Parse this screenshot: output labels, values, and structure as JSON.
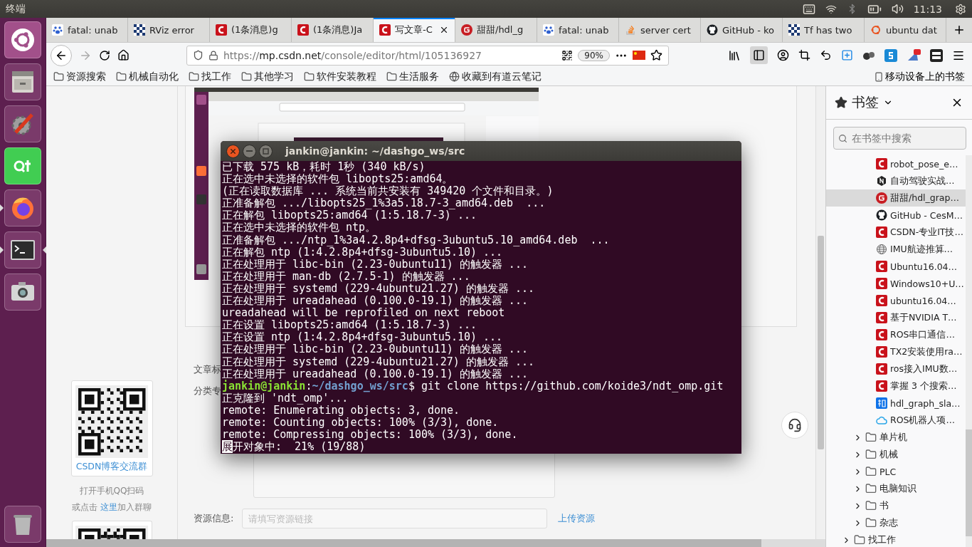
{
  "top_panel": {
    "title": "终端",
    "time": "11:13"
  },
  "launcher": [
    {
      "kind": "dash",
      "running": false,
      "focused": false
    },
    {
      "kind": "files",
      "running": false,
      "focused": false
    },
    {
      "kind": "settings",
      "running": false,
      "focused": false
    },
    {
      "kind": "qt",
      "running": false,
      "focused": false
    },
    {
      "kind": "firefox",
      "running": true,
      "focused": false
    },
    {
      "kind": "terminal",
      "running": true,
      "focused": true
    },
    {
      "kind": "camera",
      "running": false,
      "focused": false
    },
    {
      "kind": "trash",
      "running": false,
      "focused": false
    }
  ],
  "tabs": [
    {
      "title": "fatal: unab",
      "kind": "paw",
      "selected": false
    },
    {
      "title": "RViz error",
      "kind": "grid",
      "selected": false
    },
    {
      "title": "(1条消息)g",
      "kind": "csdn",
      "selected": false
    },
    {
      "title": "(1条消息)Ja",
      "kind": "csdn",
      "selected": false
    },
    {
      "title": "写文章-C",
      "kind": "csdn",
      "selected": true
    },
    {
      "title": "甜甜/hdl_g",
      "kind": "gitee",
      "selected": false
    },
    {
      "title": "fatal: unab",
      "kind": "paw",
      "selected": false
    },
    {
      "title": "server cert",
      "kind": "stack",
      "selected": false
    },
    {
      "title": "GitHub - ko",
      "kind": "github",
      "selected": false
    },
    {
      "title": "Tf has two",
      "kind": "grid",
      "selected": false
    },
    {
      "title": "ubuntu dat",
      "kind": "ubuntu",
      "selected": false
    }
  ],
  "toolbar": {
    "url_scheme": "https://",
    "url_host": "mp.csdn.net",
    "url_path": "/console/editor/html/105136927",
    "zoom": "90%"
  },
  "bookmarks_bar": [
    {
      "label": "资源搜索",
      "kind": "folder"
    },
    {
      "label": "机械自动化",
      "kind": "folder"
    },
    {
      "label": "找工作",
      "kind": "folder"
    },
    {
      "label": "其他学习",
      "kind": "folder"
    },
    {
      "label": "软件安装教程",
      "kind": "folder"
    },
    {
      "label": "生活服务",
      "kind": "folder"
    },
    {
      "label": "收藏到有道云笔记",
      "kind": "web"
    }
  ],
  "mobile_bookmarks": "移动设备上的书签",
  "qr_panel": {
    "caption": "CSDN博客交流群",
    "hint": "打开手机QQ扫码",
    "join_prefix": "或点击",
    "join_link": "这里",
    "join_suffix": "加入群聊"
  },
  "editor": {
    "tags_label": "文章标",
    "column_label": "分类专",
    "resource_label": "资源信息:",
    "resource_placeholder": "请填写资源链接",
    "upload_link": "上传资源"
  },
  "sidebar": {
    "title": "书签",
    "search_placeholder": "在书签中搜索",
    "bookmarks": [
      {
        "label": "robot_pose_e…",
        "kind": "csdn",
        "selected": false
      },
      {
        "label": "自动驾驶实战…",
        "kind": "hex",
        "selected": false
      },
      {
        "label": "甜甜/hdl_grap…",
        "kind": "gitee",
        "selected": true
      },
      {
        "label": "GitHub - CesM…",
        "kind": "github",
        "selected": false
      },
      {
        "label": "CSDN-专业IT技…",
        "kind": "csdn",
        "selected": false
      },
      {
        "label": "IMU航迹推算…",
        "kind": "globe",
        "selected": false
      },
      {
        "label": "Ubuntu16.04…",
        "kind": "csdn",
        "selected": false
      },
      {
        "label": "Windows10+U…",
        "kind": "csdn",
        "selected": false
      },
      {
        "label": "ubuntu16.04…",
        "kind": "csdn",
        "selected": false
      },
      {
        "label": "基于NVIDIA T…",
        "kind": "csdn",
        "selected": false
      },
      {
        "label": "ROS串口通信…",
        "kind": "csdn",
        "selected": false
      },
      {
        "label": "TX2安装使用ra…",
        "kind": "csdn",
        "selected": false
      },
      {
        "label": "ros接入IMU数…",
        "kind": "csdn",
        "selected": false
      },
      {
        "label": "掌握 3 个搜索…",
        "kind": "csdn",
        "selected": false
      },
      {
        "label": "hdl_graph_sla…",
        "kind": "zhihu",
        "selected": false
      },
      {
        "label": "ROS机器人项…",
        "kind": "cloud",
        "selected": false
      }
    ],
    "subfolders": [
      {
        "label": "单片机",
        "expanded": false
      },
      {
        "label": "机械",
        "expanded": false
      },
      {
        "label": "PLC",
        "expanded": false
      },
      {
        "label": "电脑知识",
        "expanded": false
      },
      {
        "label": "书",
        "expanded": false
      },
      {
        "label": "杂志",
        "expanded": false
      }
    ],
    "folders": [
      {
        "label": "找工作",
        "expanded": false
      }
    ]
  },
  "terminal": {
    "title": "jankin@jankin: ~/dashgo_ws/src",
    "lines": [
      {
        "kind": "output",
        "text": "已下载 575 kB，耗时 1秒 (340 kB/s)"
      },
      {
        "kind": "output",
        "text": "正在选中未选择的软件包 libopts25:amd64。"
      },
      {
        "kind": "output",
        "text": "(正在读取数据库 ... 系统当前共安装有 349420 个文件和目录。)"
      },
      {
        "kind": "output",
        "text": "正准备解包 .../libopts25_1%3a5.18.7-3_amd64.deb  ..."
      },
      {
        "kind": "output",
        "text": "正在解包 libopts25:amd64 (1:5.18.7-3) ..."
      },
      {
        "kind": "output",
        "text": "正在选中未选择的软件包 ntp。"
      },
      {
        "kind": "output",
        "text": "正准备解包 .../ntp_1%3a4.2.8p4+dfsg-3ubuntu5.10_amd64.deb  ..."
      },
      {
        "kind": "output",
        "text": "正在解包 ntp (1:4.2.8p4+dfsg-3ubuntu5.10) ..."
      },
      {
        "kind": "output",
        "text": "正在处理用于 libc-bin (2.23-0ubuntu11) 的触发器 ..."
      },
      {
        "kind": "output",
        "text": "正在处理用于 man-db (2.7.5-1) 的触发器 ..."
      },
      {
        "kind": "output",
        "text": "正在处理用于 systemd (229-4ubuntu21.27) 的触发器 ..."
      },
      {
        "kind": "output",
        "text": "正在处理用于 ureadahead (0.100.0-19.1) 的触发器 ..."
      },
      {
        "kind": "output",
        "text": "ureadahead will be reprofiled on next reboot"
      },
      {
        "kind": "output",
        "text": "正在设置 libopts25:amd64 (1:5.18.7-3) ..."
      },
      {
        "kind": "output",
        "text": "正在设置 ntp (1:4.2.8p4+dfsg-3ubuntu5.10) ..."
      },
      {
        "kind": "output",
        "text": "正在处理用于 libc-bin (2.23-0ubuntu11) 的触发器 ..."
      },
      {
        "kind": "output",
        "text": "正在处理用于 systemd (229-4ubuntu21.27) 的触发器 ..."
      },
      {
        "kind": "output",
        "text": "正在处理用于 ureadahead (0.100.0-19.1) 的触发器 ..."
      },
      {
        "kind": "prompt",
        "user": "jankin@jankin",
        "sep": ":",
        "path": "~/dashgo_ws/src",
        "command": "$ git clone https://github.com/koide3/ndt_omp.git"
      },
      {
        "kind": "output",
        "text": "正克隆到 'ndt_omp'..."
      },
      {
        "kind": "output",
        "text": "remote: Enumerating objects: 3, done."
      },
      {
        "kind": "output",
        "text": "remote: Counting objects: 100% (3/3), done."
      },
      {
        "kind": "output",
        "text": "remote: Compressing objects: 100% (3/3), done."
      },
      {
        "kind": "cursor",
        "cursor": "展",
        "text": "开对象中:  21% (19/88)"
      }
    ]
  }
}
